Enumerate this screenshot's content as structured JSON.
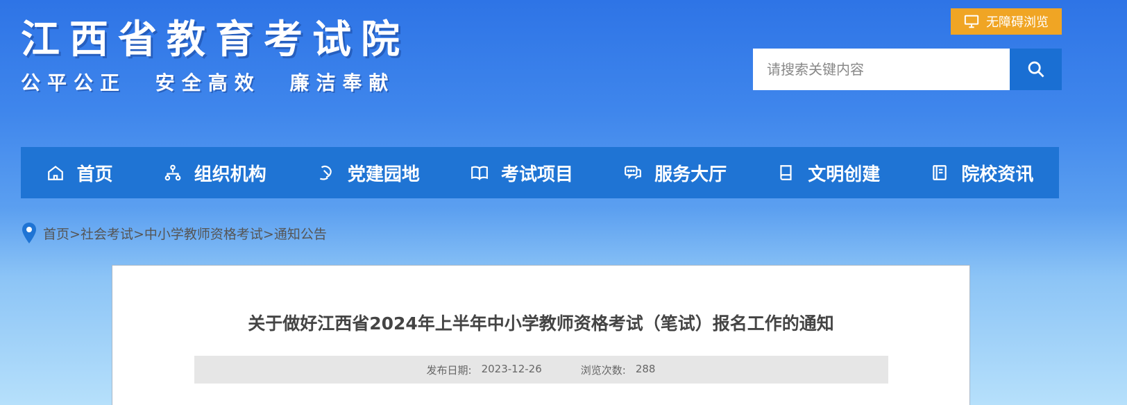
{
  "header": {
    "site_title": "江西省教育考试院",
    "slogan": "公平公正  安全高效  廉洁奉献",
    "accessibility_label": "无障碍浏览",
    "search_placeholder": "请搜索关键内容"
  },
  "nav": {
    "items": [
      {
        "label": "首页",
        "icon": "home-icon"
      },
      {
        "label": "组织机构",
        "icon": "org-chart-icon"
      },
      {
        "label": "党建园地",
        "icon": "party-emblem-icon"
      },
      {
        "label": "考试项目",
        "icon": "book-open-icon"
      },
      {
        "label": "服务大厅",
        "icon": "chat-icon"
      },
      {
        "label": "文明创建",
        "icon": "book-icon"
      },
      {
        "label": "院校资讯",
        "icon": "notebook-icon"
      }
    ]
  },
  "breadcrumb": {
    "items": [
      "首页",
      "社会考试",
      "中小学教师资格考试",
      "通知公告"
    ],
    "separator": ">"
  },
  "article": {
    "title": "关于做好江西省2024年上半年中小学教师资格考试（笔试）报名工作的通知",
    "publish_date_label": "发布日期:",
    "publish_date": "2023-12-26",
    "views_label": "浏览次数:",
    "views": "288"
  },
  "colors": {
    "nav_bg": "#1f74d4",
    "accessibility_bg": "#f0a524",
    "search_button_bg": "#1a6fd3"
  }
}
